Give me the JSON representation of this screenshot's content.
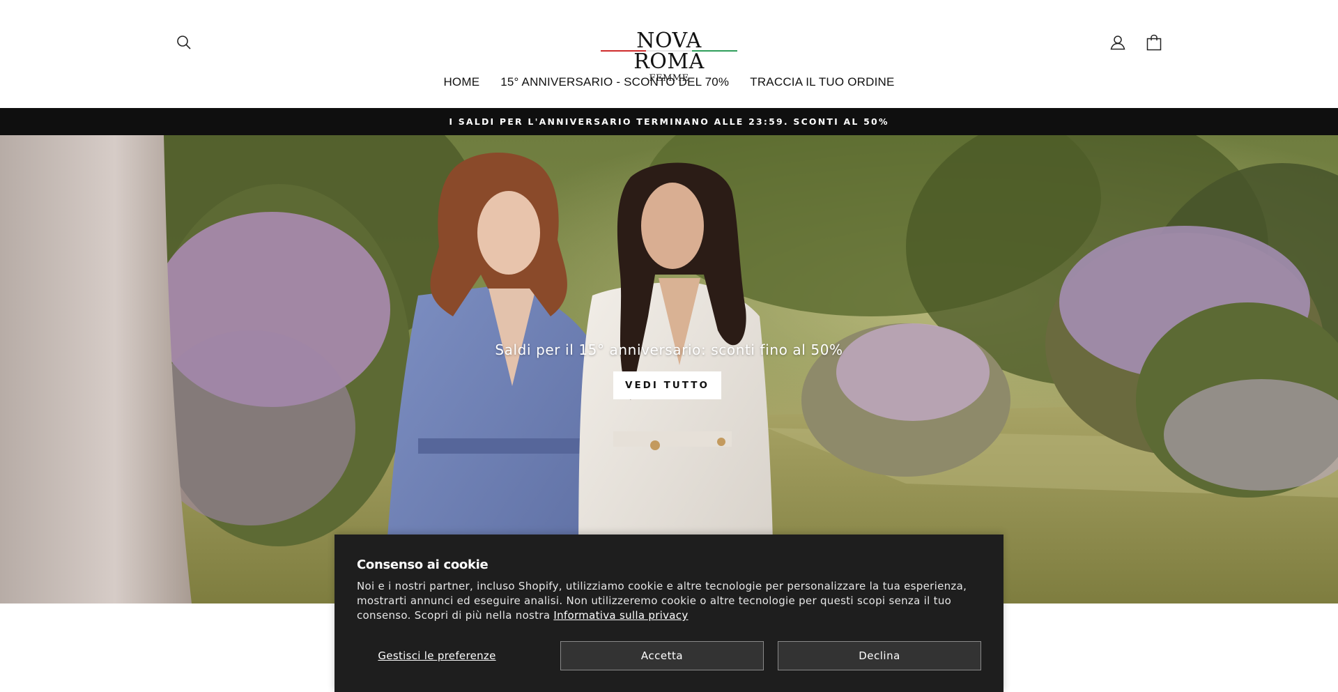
{
  "header": {
    "logo_main": "NOVA ROMA",
    "logo_sub": "FEMME",
    "logo_stripe_colors": [
      "#cf2b2b",
      "#ffffff",
      "#2f9e5a"
    ],
    "icons": {
      "search": "search-icon",
      "account": "user-icon",
      "cart": "bag-icon"
    }
  },
  "nav": {
    "items": [
      {
        "label": "HOME"
      },
      {
        "label": "15° ANNIVERSARIO - SCONTO DEL 70%"
      },
      {
        "label": "TRACCIA IL TUO ORDINE"
      }
    ]
  },
  "announcement": {
    "text": "I SALDI PER L'ANNIVERSARIO TERMINANO ALLE 23:59. SCONTI AL 50%"
  },
  "hero": {
    "title": "Saldi per il 15° anniversario: sconti fino al 50%",
    "button_label": "VEDI TUTTO"
  },
  "cookie_banner": {
    "title": "Consenso ai cookie",
    "text": "Noi e i nostri partner, incluso Shopify, utilizziamo cookie e altre tecnologie per personalizzare la tua esperienza, mostrarti annunci ed eseguire analisi. Non utilizzeremo cookie o altre tecnologie per questi scopi senza il tuo consenso. Scopri di più nella nostra ",
    "privacy_link": "Informativa sulla privacy",
    "manage_label": "Gestisci le preferenze",
    "accept_label": "Accetta",
    "decline_label": "Declina"
  }
}
